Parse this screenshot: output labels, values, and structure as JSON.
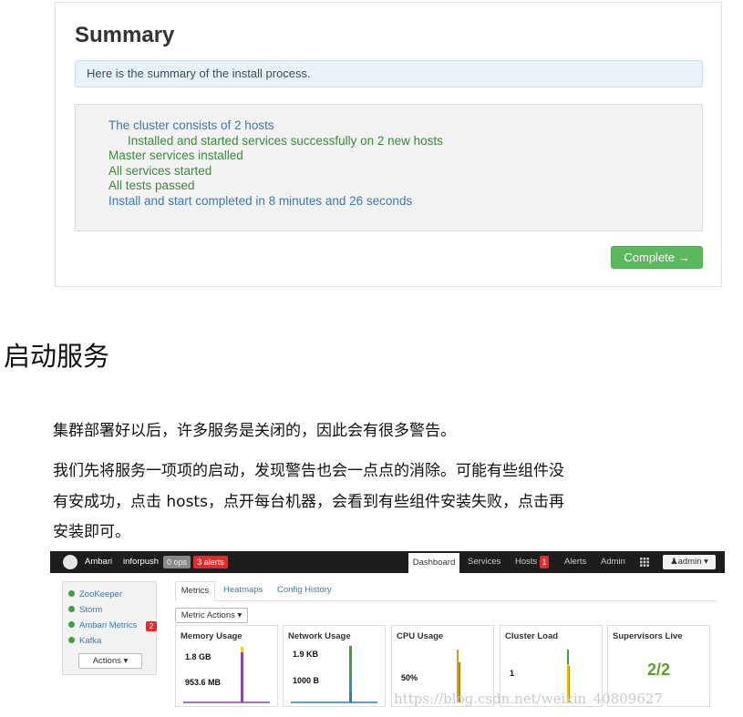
{
  "summary": {
    "title": "Summary",
    "alert": "Here is the summary of the install process.",
    "log_lines": [
      "The cluster consists of 2 hosts",
      "Installed and started services successfully on 2 new hosts",
      "Master services installed",
      "All services started",
      "All tests passed",
      "Install and start completed in 8 minutes and 26 seconds"
    ],
    "complete_button": "Complete →"
  },
  "article": {
    "heading": "启动服务",
    "p1": "集群部署好以后，许多服务是关闭的，因此会有很多警告。",
    "p2_line1": "我们先将服务一项项的启动，发现警告也会一点点的消除。可能有些组件没",
    "p2_line2": "有安成功，点击 hosts，点开每台机器，会看到有些组件安装失败，点击再",
    "p2_line3": "安装即可。"
  },
  "ambari": {
    "brand": "Ambari",
    "cluster": "inforpush",
    "ops": "0 ops",
    "alerts": "3 alerts",
    "nav": {
      "dashboard": "Dashboard",
      "services": "Services",
      "hosts": "Hosts",
      "hosts_badge": "1",
      "alerts": "Alerts",
      "admin": "Admin",
      "user": "admin"
    },
    "services": [
      "ZooKeeper",
      "Storm",
      "Ambari Metrics",
      "Kafka"
    ],
    "services_alert_badge": "2",
    "actions_button": "Actions",
    "tabs": [
      "Metrics",
      "Heatmaps",
      "Config History"
    ],
    "metric_actions": "Metric Actions",
    "cards": {
      "memory": {
        "title": "Memory Usage",
        "v1": "1.8 GB",
        "v2": "953.6 MB"
      },
      "network": {
        "title": "Network Usage",
        "v1": "1.9 KB",
        "v2": "1000 B"
      },
      "cpu": {
        "title": "CPU Usage",
        "v1": "50%"
      },
      "load": {
        "title": "Cluster Load",
        "v1": "1"
      },
      "supervisors": {
        "title": "Supervisors Live",
        "value": "2/2"
      }
    },
    "colors": {
      "topbar": "#1d1d1d",
      "alert_red": "#d9302f",
      "ok_green": "#3ea03e",
      "link_blue": "#3c7ab6"
    }
  },
  "watermark": "https://blog.csdn.net/weixin_40809627"
}
